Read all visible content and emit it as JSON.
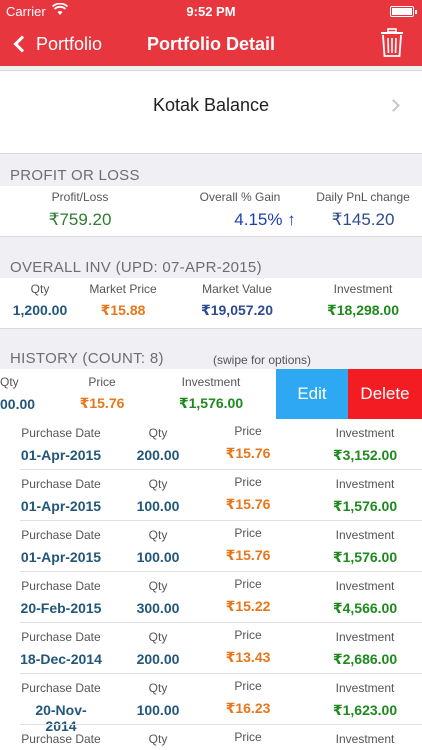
{
  "status_bar": {
    "carrier": "Carrier",
    "time": "9:52 PM"
  },
  "nav": {
    "back_label": "Portfolio",
    "title": "Portfolio Detail"
  },
  "stock": {
    "name": "Kotak Balance"
  },
  "pnl": {
    "section_title": "PROFIT OR LOSS",
    "profit_label": "Profit/Loss",
    "profit_value": "₹759.20",
    "gain_label": "Overall % Gain",
    "gain_value": "4.15%",
    "gain_arrow": "↑",
    "daily_label": "Daily PnL change",
    "daily_value": "₹145.20"
  },
  "overall": {
    "section_title": "OVERALL INV (UPD: 07-APR-2015)",
    "qty_label": "Qty",
    "qty_value": "1,200.00",
    "price_label": "Market Price",
    "price_value": "₹15.88",
    "mv_label": "Market Value",
    "mv_value": "₹19,057.20",
    "inv_label": "Investment",
    "inv_value": "₹18,298.00"
  },
  "history": {
    "section_title": "HISTORY (COUNT: 8)",
    "swipe_hint": "(swipe for options)",
    "labels": {
      "date": "Purchase Date",
      "qty": "Qty",
      "price": "Price",
      "investment": "Investment"
    },
    "swiped_row": {
      "qty": "00.00",
      "price": "₹15.76",
      "investment": "₹1,576.00",
      "edit_label": "Edit",
      "delete_label": "Delete"
    },
    "rows": [
      {
        "date": "01-Apr-2015",
        "qty": "200.00",
        "price": "₹15.76",
        "investment": "₹3,152.00"
      },
      {
        "date": "01-Apr-2015",
        "qty": "100.00",
        "price": "₹15.76",
        "investment": "₹1,576.00"
      },
      {
        "date": "01-Apr-2015",
        "qty": "100.00",
        "price": "₹15.76",
        "investment": "₹1,576.00"
      },
      {
        "date": "20-Feb-2015",
        "qty": "300.00",
        "price": "₹15.22",
        "investment": "₹4,566.00"
      },
      {
        "date": "18-Dec-2014",
        "qty": "200.00",
        "price": "₹13.43",
        "investment": "₹2,686.00"
      },
      {
        "date": "20-Nov-2014",
        "qty": "100.00",
        "price": "₹16.23",
        "investment": "₹1,623.00"
      },
      {
        "date": "",
        "qty": "",
        "price": "",
        "investment": ""
      }
    ]
  }
}
